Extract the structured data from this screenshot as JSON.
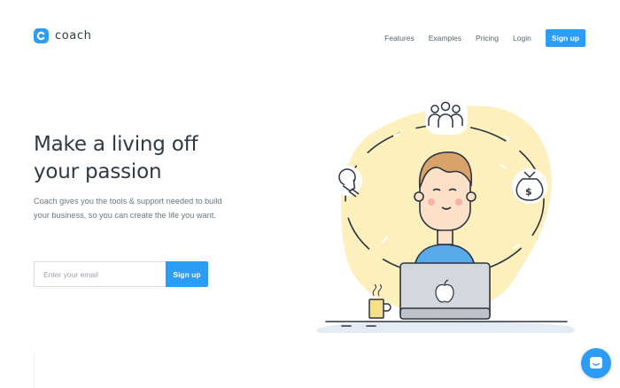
{
  "brand": {
    "name": "coach",
    "accent": "#2d9cf4"
  },
  "nav": {
    "items": [
      "Features",
      "Examples",
      "Pricing",
      "Login"
    ],
    "signup_label": "Sign up"
  },
  "hero": {
    "title_line1": "Make a living off",
    "title_line2": "your passion",
    "subtitle": "Coach gives you the tools & support needed to build your business, so you can create the life you want."
  },
  "form": {
    "email_placeholder": "Enter your email",
    "submit_label": "Sign up"
  },
  "illustration": {
    "icons": [
      "people-icon",
      "lightbulb-icon",
      "money-bag-icon",
      "coffee-mug-icon",
      "laptop-icon",
      "apple-logo-icon"
    ]
  },
  "chat": {
    "icon": "chat-icon"
  }
}
